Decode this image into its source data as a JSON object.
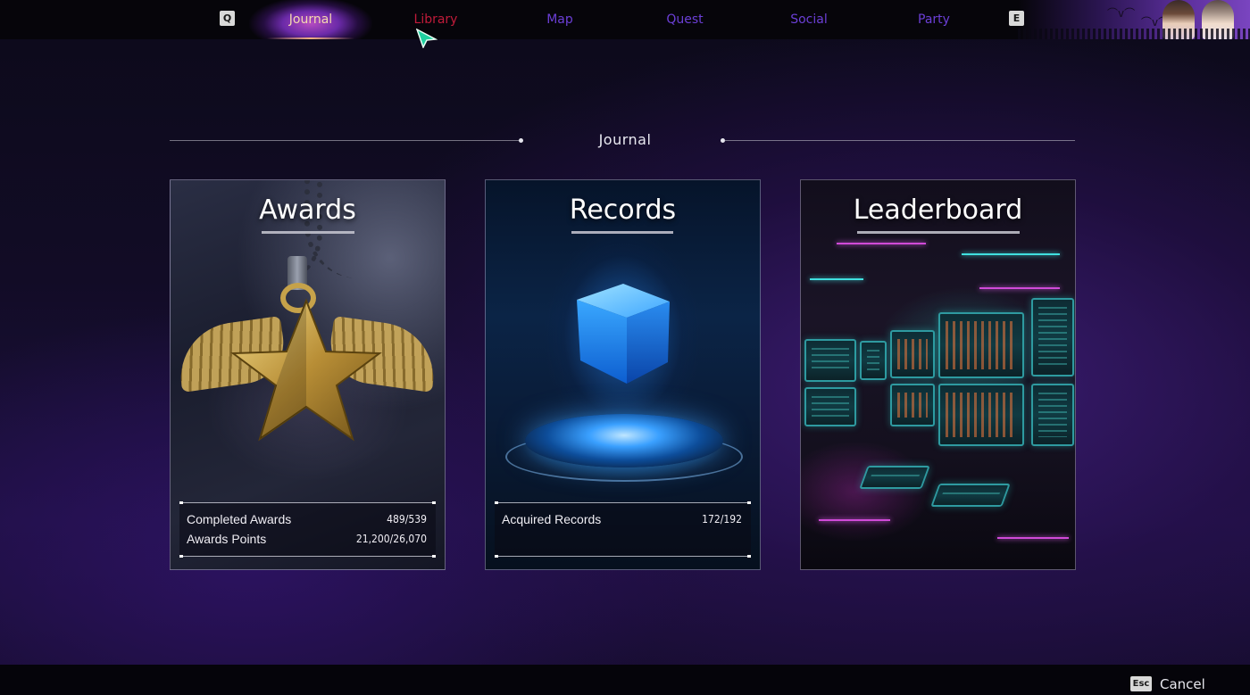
{
  "nav": {
    "prev_key": "Q",
    "next_key": "E",
    "tabs": [
      {
        "label": "Journal",
        "state": "active"
      },
      {
        "label": "Library",
        "state": "hover"
      },
      {
        "label": "Map",
        "state": "normal"
      },
      {
        "label": "Quest",
        "state": "normal"
      },
      {
        "label": "Social",
        "state": "normal"
      },
      {
        "label": "Party",
        "state": "normal"
      }
    ]
  },
  "section": {
    "title": "Journal"
  },
  "cards": {
    "awards": {
      "title": "Awards",
      "icon": "winged-star-pendant",
      "stats": [
        {
          "label": "Completed Awards",
          "value": "489/539"
        },
        {
          "label": "Awards Points",
          "value": "21,200/26,070"
        }
      ]
    },
    "records": {
      "title": "Records",
      "icon": "hologram-cube",
      "stats": [
        {
          "label": "Acquired Records",
          "value": "172/192"
        }
      ]
    },
    "leaderboard": {
      "title": "Leaderboard",
      "icon": "monitor-wall"
    }
  },
  "footer": {
    "cancel_key": "Esc",
    "cancel_label": "Cancel"
  },
  "colors": {
    "tab_inactive": "#6b3fd6",
    "tab_hover": "#c01b3a",
    "tab_active": "#f5d9b0",
    "background": "#1d1040"
  }
}
